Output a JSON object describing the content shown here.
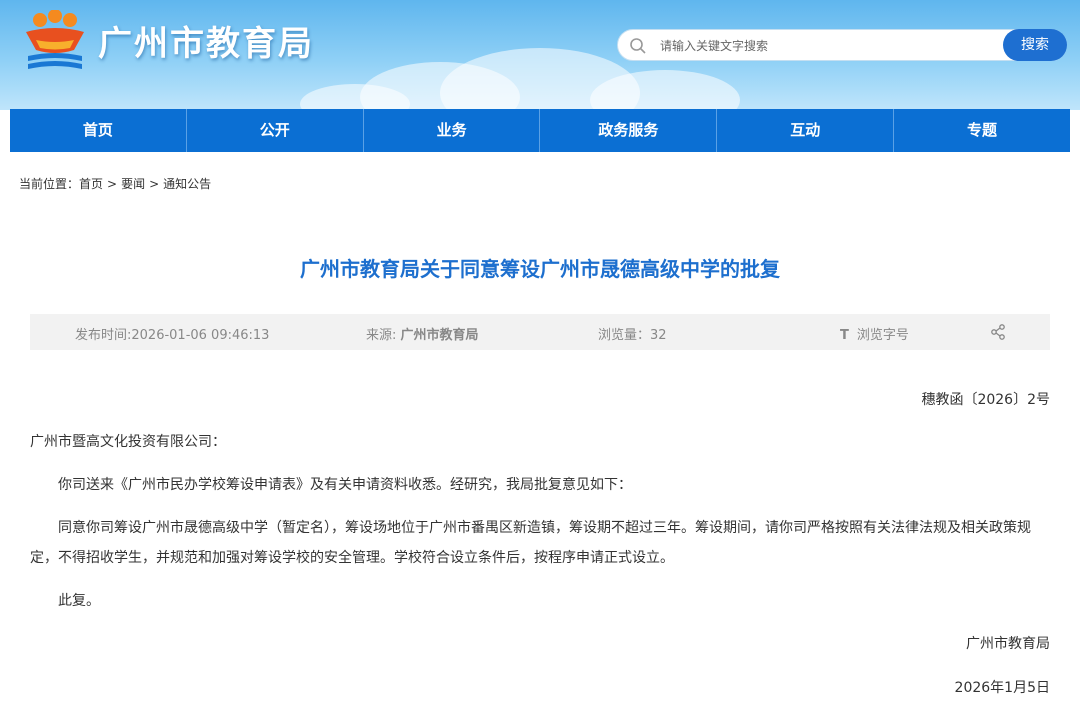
{
  "site": {
    "title": "广州市教育局"
  },
  "search": {
    "placeholder": "请输入关键文字搜索",
    "button": "搜索"
  },
  "nav": [
    "首页",
    "公开",
    "业务",
    "政务服务",
    "互动",
    "专题"
  ],
  "breadcrumb": {
    "label": "当前位置：",
    "items": [
      "首页",
      "要闻",
      "通知公告"
    ]
  },
  "article": {
    "title": "广州市教育局关于同意筹设广州市晟德高级中学的批复",
    "meta": {
      "published": "发布时间:2026-01-06 09:46:13",
      "source_label": "来源: ",
      "source": "广州市教育局",
      "views": "浏览量：32",
      "font_size": "浏览字号"
    },
    "doc_no": "穗教函〔2026〕2号",
    "recipient": "广州市暨高文化投资有限公司：",
    "paragraphs": [
      "你司送来《广州市民办学校筹设申请表》及有关申请资料收悉。经研究，我局批复意见如下：",
      "同意你司筹设广州市晟德高级中学（暂定名），筹设场地位于广州市番禺区新造镇，筹设期不超过三年。筹设期间，请你司严格按照有关法律法规及相关政策规定，不得招收学生，并规范和加强对筹设学校的安全管理。学校符合设立条件后，按程序申请正式设立。",
      "此复。"
    ],
    "signature": "广州市教育局",
    "date": "2026年1月5日"
  },
  "colors": {
    "nav": "#0b6fd3",
    "title": "#1d6fce",
    "search_button": "#1e6fd1"
  }
}
